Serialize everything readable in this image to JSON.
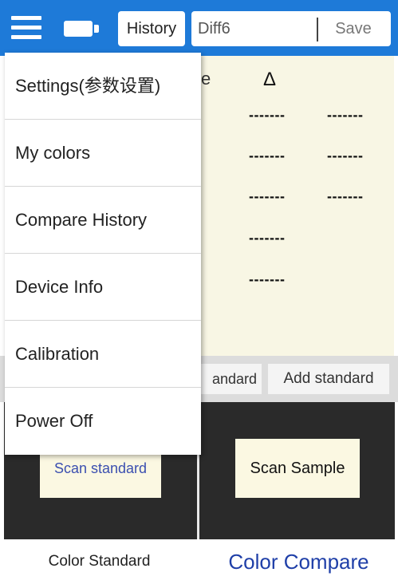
{
  "header": {
    "history_label": "History",
    "name_value": "Diff6",
    "save_label": "Save",
    "bg_color": "#1e7ad8"
  },
  "results": {
    "column_fragment": "e",
    "delta_label": "Δ",
    "rows": [
      {
        "a": "-------",
        "b": "-------"
      },
      {
        "a": "-------",
        "b": "-------"
      },
      {
        "a": "-------",
        "b": "-------"
      },
      {
        "a": "-------",
        "b": ""
      },
      {
        "a": "-------",
        "b": ""
      }
    ]
  },
  "actions": {
    "standard_fragment": "andard",
    "add_standard_label": "Add standard"
  },
  "scan": {
    "scan_standard_label": "Scan standard",
    "scan_sample_label": "Scan Sample"
  },
  "tabs": {
    "color_standard": "Color Standard",
    "color_compare": "Color Compare"
  },
  "menu": {
    "items": [
      {
        "label": "Settings(参数设置)"
      },
      {
        "label": "My colors"
      },
      {
        "label": "Compare History"
      },
      {
        "label": "Device Info"
      },
      {
        "label": "Calibration"
      },
      {
        "label": "Power Off"
      }
    ]
  }
}
